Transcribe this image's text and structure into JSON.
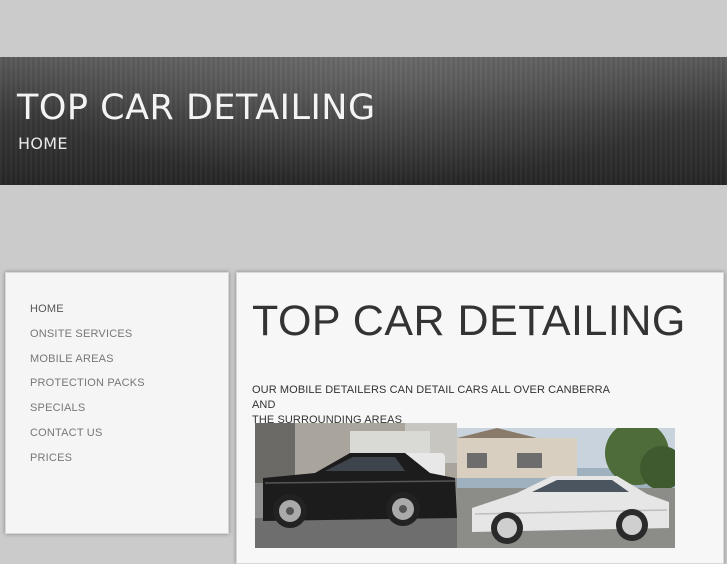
{
  "header": {
    "site_title": "TOP CAR DETAILING",
    "page_subtitle": "HOME"
  },
  "sidebar": {
    "items": [
      {
        "label": "HOME"
      },
      {
        "label": "ONSITE SERVICES"
      },
      {
        "label": "MOBILE AREAS"
      },
      {
        "label": "PROTECTION PACKS"
      },
      {
        "label": "SPECIALS"
      },
      {
        "label": "CONTACT US"
      },
      {
        "label": "PRICES"
      }
    ]
  },
  "main": {
    "title": "TOP CAR DETAILING",
    "intro_line1": "OUR MOBILE DETAILERS CAN DETAIL CARS ALL OVER CANBERRA AND",
    "intro_line2": "THE SURROUNDING AREAS"
  },
  "colors": {
    "background": "#cbcbcb",
    "banner": "#3a3a3a",
    "panel": "#f7f7f7",
    "nav_text": "#777777"
  }
}
